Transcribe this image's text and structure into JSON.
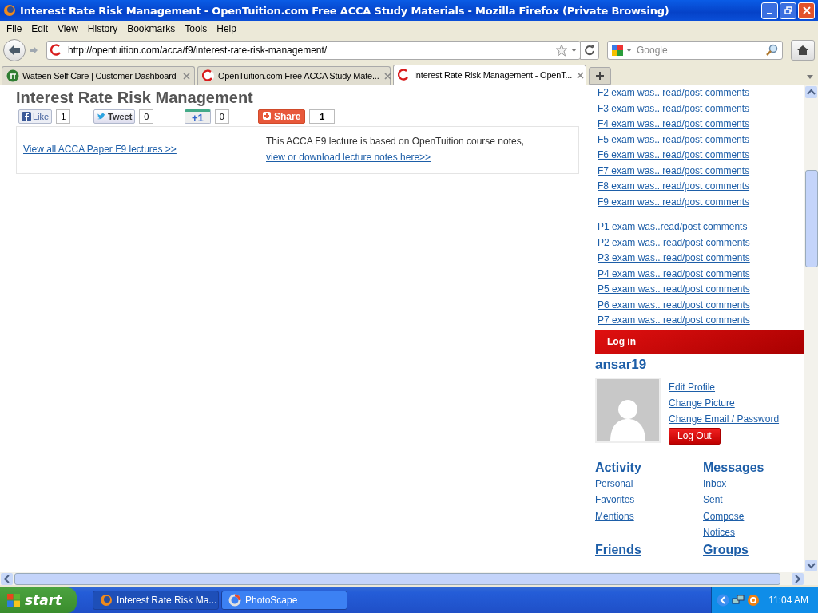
{
  "window": {
    "title": "Interest Rate Risk Management - OpenTuition.com Free ACCA Study Materials - Mozilla Firefox (Private Browsing)"
  },
  "menu": [
    "File",
    "Edit",
    "View",
    "History",
    "Bookmarks",
    "Tools",
    "Help"
  ],
  "toolbar": {
    "url": "http://opentuition.com/acca/f9/interest-rate-risk-management/",
    "search": {
      "placeholder": "Google"
    }
  },
  "tabs": [
    {
      "label": "Wateen Self Care | Customer Dashboard",
      "selected": false,
      "kind": "wateen"
    },
    {
      "label": "OpenTuition.com Free ACCA Study Mate...",
      "selected": false,
      "kind": "ot"
    },
    {
      "label": "Interest Rate Risk Management - OpenT...",
      "selected": true,
      "kind": "ot"
    }
  ],
  "page": {
    "title": "Interest Rate Risk Management",
    "share_buttons": [
      {
        "kind": "like",
        "label": "Like",
        "count": "1"
      },
      {
        "kind": "tweet",
        "label": "Tweet",
        "count": "0"
      },
      {
        "kind": "plusone",
        "label": "+1",
        "count": "0"
      },
      {
        "kind": "share",
        "label": "Share",
        "count": "1"
      }
    ],
    "lecture_box": {
      "link": "View all ACCA Paper F9 lectures >>",
      "note": "This ACCA F9 lecture is based on OpenTuition course notes, ",
      "note_link": "view or download lecture notes here>>"
    }
  },
  "sidebar": {
    "exam_groups": [
      [
        "F2 exam was.. read/post comments",
        "F3 exam was.. read/post comments",
        "F4 exam was.. read/post comments",
        "F5 exam was.. read/post comments",
        "F6 exam was.. read/post comments",
        "F7 exam was.. read/post comments",
        "F8 exam was.. read/post comments",
        "F9 exam was.. read/post comments"
      ],
      [
        "P1  exam was..read/post comments",
        "P2 exam was.. read/post comments",
        "P3 exam was.. read/post comments",
        "P4 exam was.. read/post comments",
        "P5 exam was.. read/post comments",
        "P6 exam was.. read/post comments",
        "P7 exam was.. read/post comments"
      ]
    ],
    "login": {
      "header": "Log in",
      "username": "ansar19",
      "profile_links": [
        "Edit Profile",
        "Change Picture",
        "Change Email / Password"
      ],
      "logout": "Log Out"
    },
    "sections": [
      {
        "heading": "Activity",
        "items": [
          "Personal",
          "Favorites",
          "Mentions"
        ]
      },
      {
        "heading": "Messages",
        "items": [
          "Inbox",
          "Sent",
          "Compose",
          "Notices"
        ]
      },
      {
        "heading": "Friends"
      },
      {
        "heading": "Groups"
      }
    ]
  },
  "taskbar": {
    "start": "start",
    "tasks": [
      {
        "label": "Interest Rate Risk Ma...",
        "selected": true,
        "kind": "firefox"
      },
      {
        "label": "PhotoScape",
        "selected": false,
        "kind": "photoscape"
      }
    ],
    "clock": "11:04 AM"
  }
}
